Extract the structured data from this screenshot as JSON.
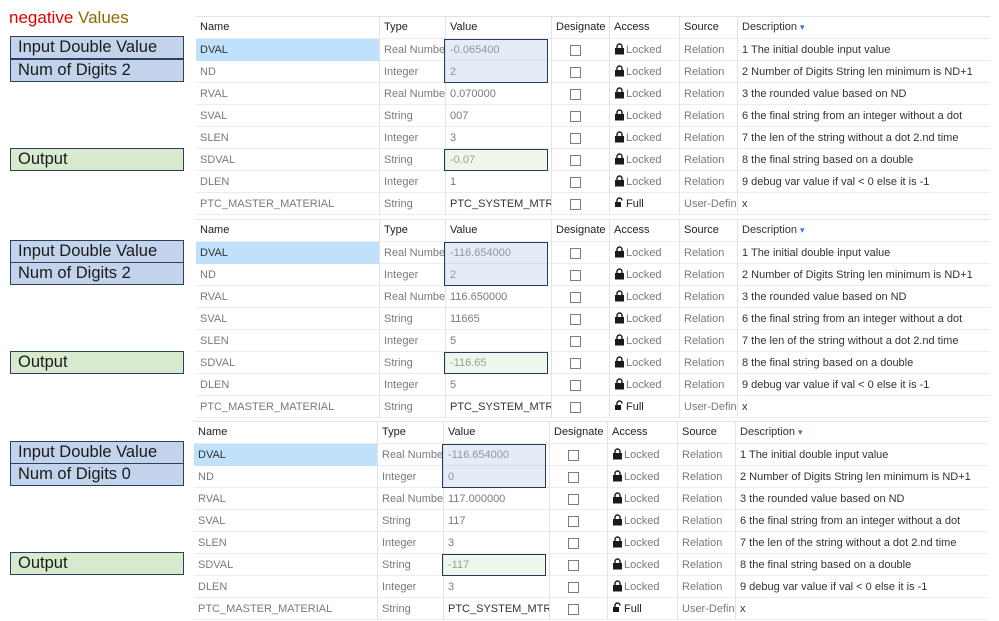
{
  "title": {
    "part1": "negative",
    "part2": "Values"
  },
  "headers": [
    "Name",
    "Type",
    "Value",
    "Designate",
    "Access",
    "Source",
    "Description"
  ],
  "colors": {
    "input": "#c3d3ec",
    "output": "#d7eacd",
    "selected_row": "#bfe1fb",
    "border": "#243a5a"
  },
  "panels": [
    {
      "labels": {
        "input": "Input Double Value",
        "digits": "Num of Digits 2",
        "output": "Output"
      },
      "rows": [
        {
          "name": "DVAL",
          "type": "Real Number",
          "value": "-0.065400",
          "access": "Locked",
          "source": "Relation",
          "desc": "1 The initial double input value"
        },
        {
          "name": "ND",
          "type": "Integer",
          "value": "2",
          "access": "Locked",
          "source": "Relation",
          "desc": "2 Number of Digits String len minimum is ND+1"
        },
        {
          "name": "RVAL",
          "type": "Real Number",
          "value": "0.070000",
          "access": "Locked",
          "source": "Relation",
          "desc": "3 the rounded value based on ND"
        },
        {
          "name": "SVAL",
          "type": "String",
          "value": "007",
          "access": "Locked",
          "source": "Relation",
          "desc": "6 the final string from an integer without a dot"
        },
        {
          "name": "SLEN",
          "type": "Integer",
          "value": "3",
          "access": "Locked",
          "source": "Relation",
          "desc": "7 the len of the string without a dot 2.nd time"
        },
        {
          "name": "SDVAL",
          "type": "String",
          "value": "-0.07",
          "access": "Locked",
          "source": "Relation",
          "desc": "8 the final string based on a double"
        },
        {
          "name": "DLEN",
          "type": "Integer",
          "value": "1",
          "access": "Locked",
          "source": "Relation",
          "desc": "9 debug var value if val < 0 else it is -1"
        },
        {
          "name": "PTC_MASTER_MATERIAL",
          "type": "String",
          "value": "PTC_SYSTEM_MTRL_PF",
          "access": "Full",
          "source": "User-Defined",
          "desc": "x"
        }
      ]
    },
    {
      "labels": {
        "input": "Input Double Value",
        "digits": "Num of Digits 2",
        "output": "Output"
      },
      "rows": [
        {
          "name": "DVAL",
          "type": "Real Number",
          "value": "-116.654000",
          "access": "Locked",
          "source": "Relation",
          "desc": "1 The initial double input value"
        },
        {
          "name": "ND",
          "type": "Integer",
          "value": "2",
          "access": "Locked",
          "source": "Relation",
          "desc": "2 Number of Digits String len minimum is ND+1"
        },
        {
          "name": "RVAL",
          "type": "Real Number",
          "value": "116.650000",
          "access": "Locked",
          "source": "Relation",
          "desc": "3 the rounded value based on ND"
        },
        {
          "name": "SVAL",
          "type": "String",
          "value": "11665",
          "access": "Locked",
          "source": "Relation",
          "desc": "6 the final string from an integer without a dot"
        },
        {
          "name": "SLEN",
          "type": "Integer",
          "value": "5",
          "access": "Locked",
          "source": "Relation",
          "desc": "7 the len of the string without a dot 2.nd time"
        },
        {
          "name": "SDVAL",
          "type": "String",
          "value": "-116.65",
          "access": "Locked",
          "source": "Relation",
          "desc": "8 the final string based on a double"
        },
        {
          "name": "DLEN",
          "type": "Integer",
          "value": "5",
          "access": "Locked",
          "source": "Relation",
          "desc": "9 debug var value if val < 0 else it is -1"
        },
        {
          "name": "PTC_MASTER_MATERIAL",
          "type": "String",
          "value": "PTC_SYSTEM_MTRL_PF",
          "access": "Full",
          "source": "User-Defined",
          "desc": "x"
        }
      ]
    },
    {
      "labels": {
        "input": "Input Double Value",
        "digits": "Num of Digits 0",
        "output": "Output"
      },
      "rows": [
        {
          "name": "DVAL",
          "type": "Real Number",
          "value": "-116.654000",
          "access": "Locked",
          "source": "Relation",
          "desc": "1 The initial double input value"
        },
        {
          "name": "ND",
          "type": "Integer",
          "value": "0",
          "access": "Locked",
          "source": "Relation",
          "desc": "2 Number of Digits String len minimum is ND+1"
        },
        {
          "name": "RVAL",
          "type": "Real Number",
          "value": "117.000000",
          "access": "Locked",
          "source": "Relation",
          "desc": "3 the rounded value based on ND"
        },
        {
          "name": "SVAL",
          "type": "String",
          "value": "117",
          "access": "Locked",
          "source": "Relation",
          "desc": "6 the final string from an integer without a dot"
        },
        {
          "name": "SLEN",
          "type": "Integer",
          "value": "3",
          "access": "Locked",
          "source": "Relation",
          "desc": "7 the len of the string without a dot 2.nd time"
        },
        {
          "name": "SDVAL",
          "type": "String",
          "value": "-117",
          "access": "Locked",
          "source": "Relation",
          "desc": "8 the final string based on a double"
        },
        {
          "name": "DLEN",
          "type": "Integer",
          "value": "3",
          "access": "Locked",
          "source": "Relation",
          "desc": "9 debug var value if val < 0 else it is -1"
        },
        {
          "name": "PTC_MASTER_MATERIAL",
          "type": "String",
          "value": "PTC_SYSTEM_MTRL_PF",
          "access": "Full",
          "source": "User-Defined",
          "desc": "x"
        }
      ]
    }
  ]
}
